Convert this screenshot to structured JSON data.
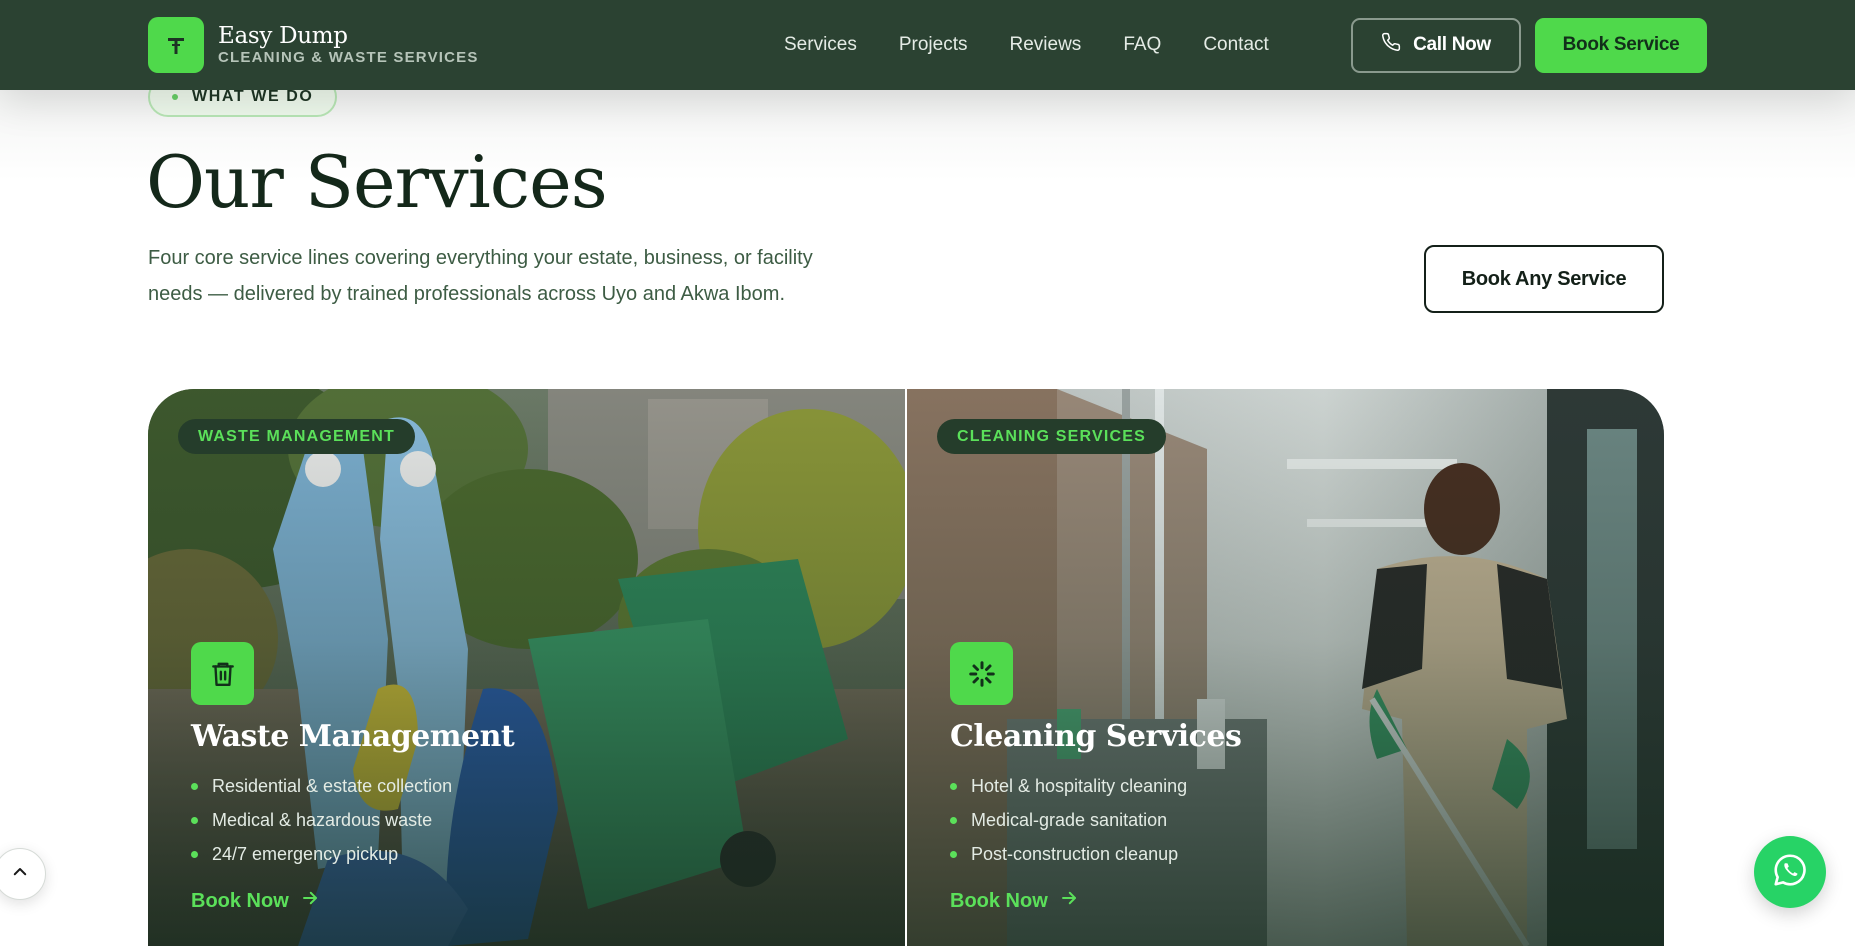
{
  "navbar": {
    "brand_name": "Easy Dump",
    "brand_sub": "CLEANING & WASTE SERVICES",
    "links": [
      "Services",
      "Projects",
      "Reviews",
      "FAQ",
      "Contact"
    ],
    "call_label": "Call Now",
    "book_label": "Book Service",
    "colors": {
      "background": "#2b4232",
      "accent": "#4fd94b"
    }
  },
  "section": {
    "eyebrow": "WHAT WE DO",
    "title": "Our Services",
    "description": "Four core service lines covering everything your estate, business, or facility needs — delivered by trained professionals across Uyo and Akwa Ibom.",
    "book_any_label": "Book Any Service"
  },
  "cards": [
    {
      "tag": "WASTE MANAGEMENT",
      "icon": "trash-icon",
      "title": "Waste Management",
      "items": [
        "Residential & estate collection",
        "Medical & hazardous waste",
        "24/7 emergency pickup"
      ],
      "link_label": "Book Now"
    },
    {
      "tag": "CLEANING SERVICES",
      "icon": "sparkle-icon",
      "title": "Cleaning Services",
      "items": [
        "Hotel & hospitality cleaning",
        "Medical-grade sanitation",
        "Post-construction cleanup"
      ],
      "link_label": "Book Now"
    }
  ],
  "floating": {
    "scroll_top_icon": "chevron-up-icon",
    "whatsapp_icon": "whatsapp-icon"
  }
}
